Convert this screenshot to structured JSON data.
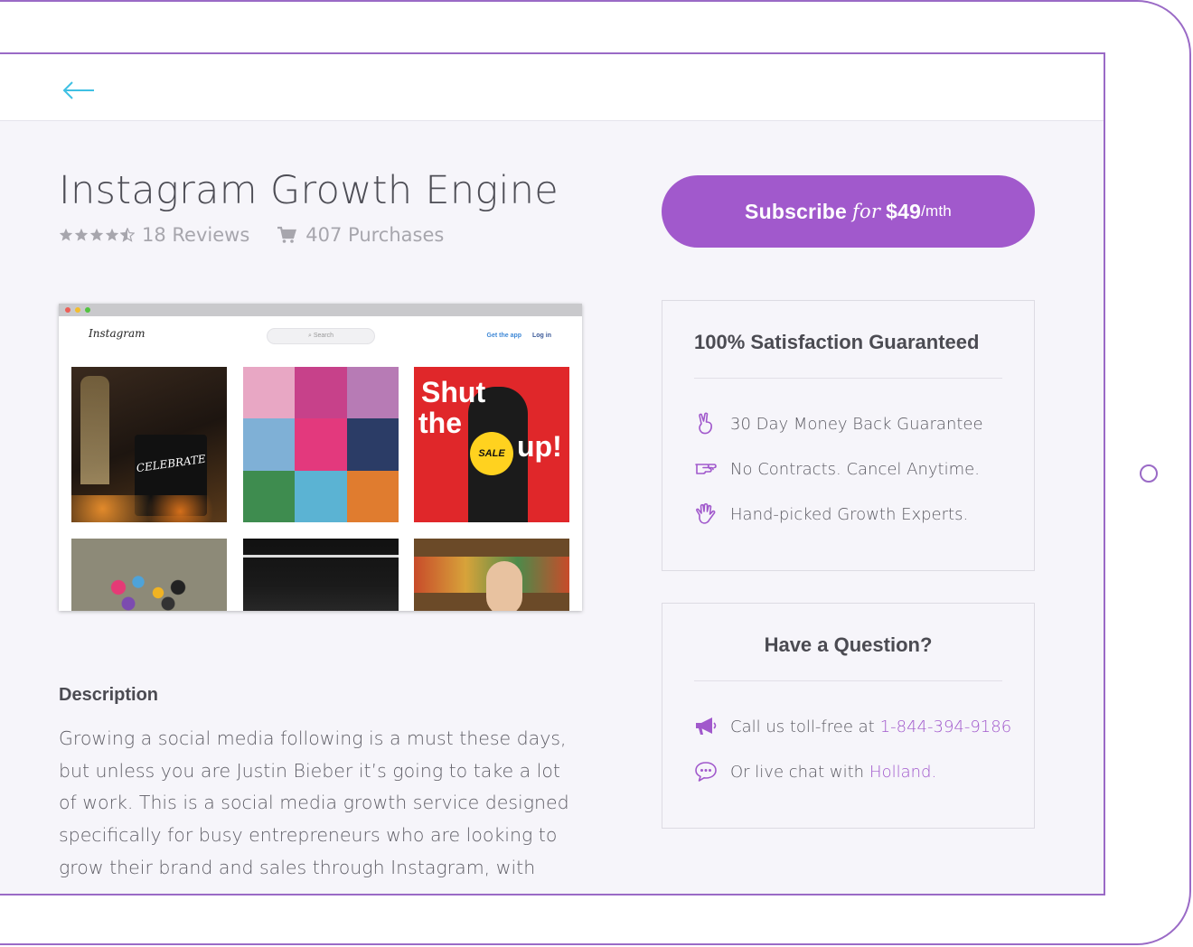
{
  "product": {
    "title": "Instagram Growth Engine",
    "reviews": "18 Reviews",
    "purchases": "407 Purchases",
    "rating": 4.5
  },
  "subscribe": {
    "label": "Subscribe",
    "for": "for",
    "price": "$49",
    "period": "/mth"
  },
  "preview": {
    "logo": "Instagram",
    "search_placeholder": "Search",
    "get_app": "Get the app",
    "login": "Log in",
    "tile_texts": {
      "shut": "Shut",
      "the": "the",
      "up": "up!",
      "sale": "SALE",
      "celebrate": "CELEBRATE"
    }
  },
  "description": {
    "heading": "Description",
    "text": "Growing a social media following is a must these days, but unless you are Justin Bieber it’s going to take a lot of work. This is a social media growth service designed specifically for busy entrepreneurs who are looking to grow their brand and sales through Instagram, with"
  },
  "guarantee": {
    "title": "100% Satisfaction Guaranteed",
    "items": [
      {
        "icon": "peace-hand-icon",
        "text": "30 Day Money Back Guarantee"
      },
      {
        "icon": "handshake-icon",
        "text": "No Contracts. Cancel Anytime."
      },
      {
        "icon": "raised-hand-icon",
        "text": "Hand-picked Growth Experts."
      }
    ]
  },
  "question": {
    "title": "Have a Question?",
    "call_text": "Call us toll-free at",
    "phone": "1-844-394-9186",
    "chat_text": "Or live chat with",
    "chat_agent": "Holland."
  },
  "colors": {
    "accent": "#a159cc",
    "frame": "#9a6ac6",
    "back_arrow": "#3fc0e3"
  }
}
